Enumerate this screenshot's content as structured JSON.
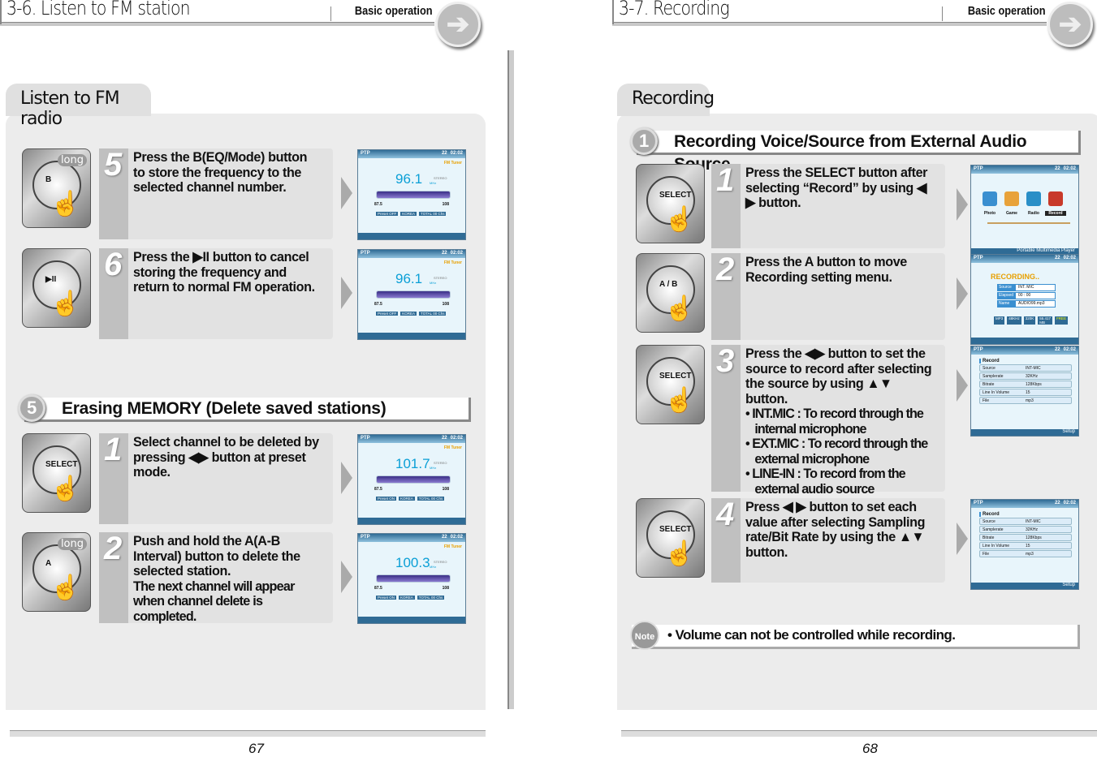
{
  "left": {
    "title": "3-6. Listen to FM station",
    "header_right": "Basic operation",
    "tab": "Listen to FM radio",
    "section": {
      "num": "5",
      "title": "Erasing MEMORY (Delete saved stations)"
    },
    "page_number": "67",
    "steps": [
      {
        "num": "5",
        "device": {
          "label": "B",
          "badge": "long"
        },
        "lines": [
          "Press the B(EQ/Mode) button to store the frequency to the selected channel number."
        ],
        "screen": {
          "type": "fm",
          "freq": "96.1",
          "preset": "Preset OFF"
        }
      },
      {
        "num": "6",
        "device": {
          "label": "▶II",
          "badge": ""
        },
        "lines": [
          "Press the ▶II button to cancel storing the frequency and return to normal FM operation."
        ],
        "screen": {
          "type": "fm",
          "freq": "96.1",
          "preset": "Preset OFF"
        }
      },
      {
        "num": "1",
        "device": {
          "label": "SELECT",
          "badge": ""
        },
        "lines": [
          "Select channel to be deleted by pressing ◀▶ button at preset mode."
        ],
        "screen": {
          "type": "fm",
          "freq": "101.7",
          "preset": "Preset ON"
        }
      },
      {
        "num": "2",
        "device": {
          "label": "A",
          "badge": "long"
        },
        "lines": [
          "Push and hold the A(A-B Interval) button to delete the selected station."
        ],
        "sub": [
          "The next channel will appear when channel delete is completed."
        ],
        "screen": {
          "type": "fm",
          "freq": "100.3",
          "preset": "Preset ON"
        }
      }
    ]
  },
  "right": {
    "title": "3-7. Recording",
    "header_right": "Basic operation",
    "tab": "Recording",
    "section": {
      "num": "1",
      "title": "Recording Voice/Source from External Audio Source"
    },
    "page_number": "68",
    "note": {
      "badge": "Note",
      "text": "Volume can not be controlled while recording."
    },
    "steps": [
      {
        "num": "1",
        "device": {
          "label": "SELECT",
          "badge": ""
        },
        "lines": [
          "Press the SELECT button after selecting “Record” by using ◀ ▶ button."
        ],
        "screen": {
          "type": "menu"
        }
      },
      {
        "num": "2",
        "device": {
          "label": "A / B",
          "badge": ""
        },
        "lines": [
          "Press the A button to move Recording setting menu."
        ],
        "screen": {
          "type": "rec"
        }
      },
      {
        "num": "3",
        "device": {
          "label": "SELECT",
          "badge": ""
        },
        "lines": [
          "Press the ◀▶ button to set the source to record after selecting the source by using ▲▼ button."
        ],
        "bullets": [
          "INT.MIC : To record through the internal microphone",
          "EXT.MIC : To record through the external microphone",
          "LINE-IN : To record from the external audio source"
        ],
        "screen": {
          "type": "settings"
        }
      },
      {
        "num": "4",
        "device": {
          "label": "SELECT",
          "badge": ""
        },
        "lines": [
          "Press ◀ ▶ button to set each value after selecting Sampling rate/Bit Rate by using the ▲▼ button."
        ],
        "screen": {
          "type": "settings"
        }
      }
    ]
  },
  "screens": {
    "brand": "PTP",
    "battery": "22",
    "time": "02:02",
    "fm": {
      "mode": "FM Tuner",
      "unit": "MHz",
      "stereo": "STEREO",
      "min": "87.5",
      "max": "108",
      "region": "KOREA",
      "total": "TOTAL 00 Chs"
    },
    "menu": {
      "items": [
        "Photo",
        "Game",
        "Radio",
        "Record"
      ],
      "footer": "Portable Multimedia Player"
    },
    "rec": {
      "status": "RECORDING..",
      "rows": [
        [
          "Source",
          "INT. MIC"
        ],
        [
          "Elapsed",
          "00 : 00"
        ],
        [
          "Name",
          "AUDIO99.mp3"
        ]
      ],
      "chips": [
        "MP3",
        "48KHz",
        "320K",
        "55.417 MB",
        "FREE"
      ]
    },
    "settings": {
      "title": "Record",
      "rows": [
        [
          "Source",
          "INT-MIC"
        ],
        [
          "Samplerate",
          "32KHz"
        ],
        [
          "Bitrate",
          "128Kbps"
        ],
        [
          "Line In Volume",
          "15"
        ],
        [
          "File",
          "mp3"
        ]
      ],
      "footer": "Setup"
    }
  }
}
